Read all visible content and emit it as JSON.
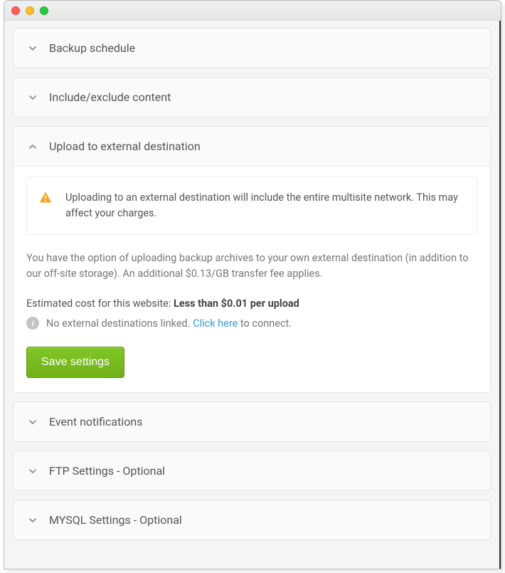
{
  "sections": {
    "backup_schedule": {
      "title": "Backup schedule",
      "expanded": false
    },
    "include_exclude": {
      "title": "Include/exclude content",
      "expanded": false
    },
    "upload_external": {
      "title": "Upload to external destination",
      "expanded": true,
      "warning": "Uploading to an external destination will include the entire multisite network. This may affect your charges.",
      "description": "You have the option of uploading backup archives to your own external destination (in addition to our off-site storage). An additional $0.13/GB transfer fee applies.",
      "estimate_label": "Estimated cost for this website: ",
      "estimate_value": "Less than $0.01 per upload",
      "info_prefix": "No external destinations linked. ",
      "info_link": "Click here",
      "info_suffix": " to connect.",
      "save_label": "Save settings"
    },
    "event_notifications": {
      "title": "Event notifications",
      "expanded": false
    },
    "ftp_settings": {
      "title": "FTP Settings - Optional",
      "expanded": false
    },
    "mysql_settings": {
      "title": "MYSQL Settings - Optional",
      "expanded": false
    }
  },
  "colors": {
    "accent_green": "#78b91f",
    "link_blue": "#2e9fd8",
    "warn_orange": "#f5a623"
  }
}
